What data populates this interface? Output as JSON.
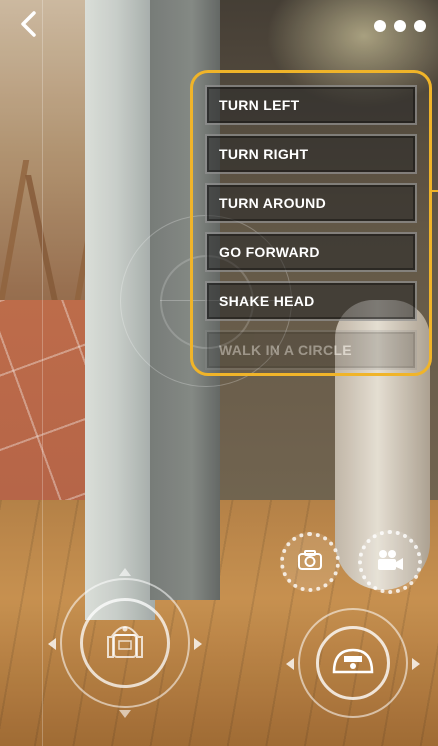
{
  "top_bar": {
    "back_icon": "chevron-left-icon",
    "more_icon": "more-dots-icon"
  },
  "action_menu": {
    "accent_color": "#f0b429",
    "items": [
      {
        "label": "TURN LEFT"
      },
      {
        "label": "TURN RIGHT"
      },
      {
        "label": "TURN AROUND"
      },
      {
        "label": "GO FORWARD"
      },
      {
        "label": "SHAKE HEAD"
      },
      {
        "label": "WALK IN A CIRCLE"
      }
    ]
  },
  "controls": {
    "photo_icon": "camera-icon",
    "video_icon": "video-camera-icon",
    "left_joystick_icon": "robot-icon",
    "right_joystick_icon": "robot-head-icon"
  }
}
